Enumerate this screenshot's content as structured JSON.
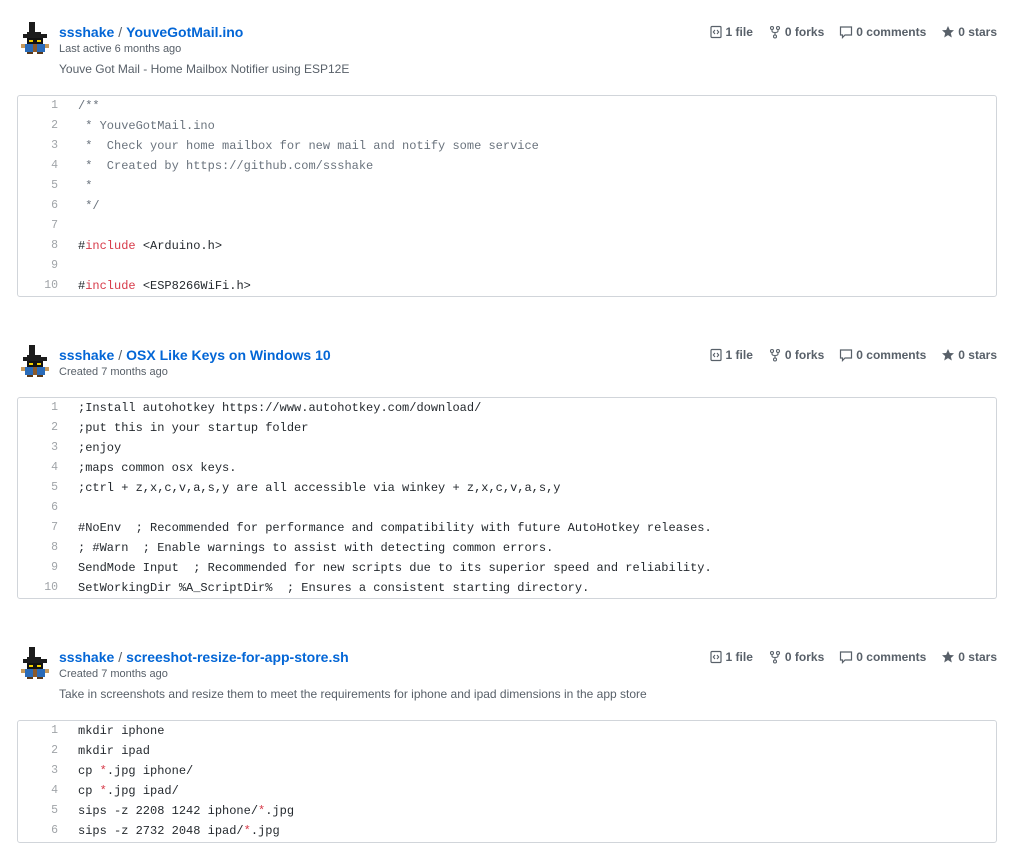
{
  "gists": [
    {
      "owner": "ssshake",
      "separator": "/",
      "name": "YouveGotMail.ino",
      "meta": "Last active 6 months ago",
      "description": "Youve Got Mail - Home Mailbox Notifier using ESP12E",
      "counts": {
        "files": "1 file",
        "forks": "0 forks",
        "comments": "0 comments",
        "stars": "0 stars"
      },
      "lines": [
        {
          "n": "1",
          "parts": [
            {
              "t": "/**",
              "c": "cm"
            }
          ]
        },
        {
          "n": "2",
          "parts": [
            {
              "t": " * YouveGotMail.ino",
              "c": "cm"
            }
          ]
        },
        {
          "n": "3",
          "parts": [
            {
              "t": " *  Check your home mailbox for new mail and notify some service",
              "c": "cm"
            }
          ]
        },
        {
          "n": "4",
          "parts": [
            {
              "t": " *  Created by https://github.com/ssshake",
              "c": "cm"
            }
          ]
        },
        {
          "n": "5",
          "parts": [
            {
              "t": " *",
              "c": "cm"
            }
          ]
        },
        {
          "n": "6",
          "parts": [
            {
              "t": " */",
              "c": "cm"
            }
          ]
        },
        {
          "n": "7",
          "parts": [
            {
              "t": "",
              "c": "txt"
            }
          ]
        },
        {
          "n": "8",
          "parts": [
            {
              "t": "#",
              "c": "txt"
            },
            {
              "t": "include",
              "c": "kw"
            },
            {
              "t": " <Arduino.h>",
              "c": "txt"
            }
          ]
        },
        {
          "n": "9",
          "parts": [
            {
              "t": "",
              "c": "txt"
            }
          ]
        },
        {
          "n": "10",
          "parts": [
            {
              "t": "#",
              "c": "txt"
            },
            {
              "t": "include",
              "c": "kw"
            },
            {
              "t": " <ESP8266WiFi.h>",
              "c": "txt"
            }
          ]
        }
      ]
    },
    {
      "owner": "ssshake",
      "separator": "/",
      "name": "OSX Like Keys on Windows 10",
      "meta": "Created 7 months ago",
      "description": "",
      "counts": {
        "files": "1 file",
        "forks": "0 forks",
        "comments": "0 comments",
        "stars": "0 stars"
      },
      "lines": [
        {
          "n": "1",
          "parts": [
            {
              "t": ";Install autohotkey https://www.autohotkey.com/download/",
              "c": "txt"
            }
          ]
        },
        {
          "n": "2",
          "parts": [
            {
              "t": ";put this in your startup folder",
              "c": "txt"
            }
          ]
        },
        {
          "n": "3",
          "parts": [
            {
              "t": ";enjoy",
              "c": "txt"
            }
          ]
        },
        {
          "n": "4",
          "parts": [
            {
              "t": ";maps common osx keys.",
              "c": "txt"
            }
          ]
        },
        {
          "n": "5",
          "parts": [
            {
              "t": ";ctrl + z,x,c,v,a,s,y are all accessible via winkey + z,x,c,v,a,s,y",
              "c": "txt"
            }
          ]
        },
        {
          "n": "6",
          "parts": [
            {
              "t": "",
              "c": "txt"
            }
          ]
        },
        {
          "n": "7",
          "parts": [
            {
              "t": "#NoEnv  ; Recommended for performance and compatibility with future AutoHotkey releases.",
              "c": "txt"
            }
          ]
        },
        {
          "n": "8",
          "parts": [
            {
              "t": "; #Warn  ; Enable warnings to assist with detecting common errors.",
              "c": "txt"
            }
          ]
        },
        {
          "n": "9",
          "parts": [
            {
              "t": "SendMode Input  ; Recommended for new scripts due to its superior speed and reliability.",
              "c": "txt"
            }
          ]
        },
        {
          "n": "10",
          "parts": [
            {
              "t": "SetWorkingDir %A_ScriptDir%  ; Ensures a consistent starting directory.",
              "c": "txt"
            }
          ]
        }
      ]
    },
    {
      "owner": "ssshake",
      "separator": "/",
      "name": "screeshot-resize-for-app-store.sh",
      "meta": "Created 7 months ago",
      "description": "Take in screenshots and resize them to meet the requirements for iphone and ipad dimensions in the app store",
      "counts": {
        "files": "1 file",
        "forks": "0 forks",
        "comments": "0 comments",
        "stars": "0 stars"
      },
      "lines": [
        {
          "n": "1",
          "parts": [
            {
              "t": "mkdir iphone",
              "c": "txt"
            }
          ]
        },
        {
          "n": "2",
          "parts": [
            {
              "t": "mkdir ipad",
              "c": "txt"
            }
          ]
        },
        {
          "n": "3",
          "parts": [
            {
              "t": "cp ",
              "c": "txt"
            },
            {
              "t": "*",
              "c": "red"
            },
            {
              "t": ".jpg iphone/",
              "c": "txt"
            }
          ]
        },
        {
          "n": "4",
          "parts": [
            {
              "t": "cp ",
              "c": "txt"
            },
            {
              "t": "*",
              "c": "red"
            },
            {
              "t": ".jpg ipad/",
              "c": "txt"
            }
          ]
        },
        {
          "n": "5",
          "parts": [
            {
              "t": "sips -z 2208 1242 iphone/",
              "c": "txt"
            },
            {
              "t": "*",
              "c": "red"
            },
            {
              "t": ".jpg",
              "c": "txt"
            }
          ]
        },
        {
          "n": "6",
          "parts": [
            {
              "t": "sips -z 2732 2048 ipad/",
              "c": "txt"
            },
            {
              "t": "*",
              "c": "red"
            },
            {
              "t": ".jpg",
              "c": "txt"
            }
          ]
        }
      ]
    }
  ],
  "icons": {
    "files": "code-file-icon",
    "forks": "fork-icon",
    "comments": "comment-icon",
    "stars": "star-icon",
    "avatar": "black-mage-avatar"
  },
  "colors": {
    "link": "#0366d6",
    "muted": "#586069",
    "keyword": "#d73a49",
    "comment": "#6a737d"
  }
}
